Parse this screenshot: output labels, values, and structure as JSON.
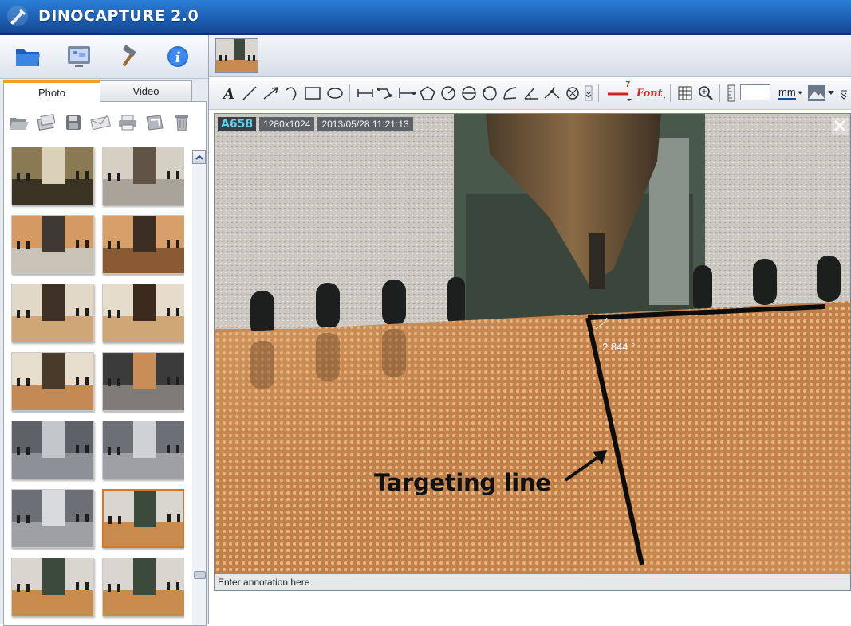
{
  "app": {
    "title": "DINOCAPTURE 2.0",
    "accent_color": "#1c5fb3",
    "selected_color": "#e0751d"
  },
  "left_panel": {
    "top_tools": [
      {
        "name": "folder-icon"
      },
      {
        "name": "monitor-icon"
      },
      {
        "name": "hammer-icon"
      },
      {
        "name": "info-icon"
      }
    ],
    "tabs": [
      {
        "label": "Photo",
        "active": true
      },
      {
        "label": "Video",
        "active": false
      }
    ],
    "photo_tools": [
      "open-folder-icon",
      "export-icon",
      "save-icon",
      "email-icon",
      "print-icon",
      "edit-icon",
      "trash-icon"
    ],
    "thumbnails_count": 14,
    "selected_thumbnail": 11
  },
  "toolbar": {
    "line_width_label": "7",
    "font_label": "Font",
    "unit_label": "mm",
    "value_field": ""
  },
  "viewer": {
    "image_id": "A658",
    "resolution": "1280x1024",
    "timestamp": "2013/05/28 11:21:13",
    "angle_label": "2.844 °",
    "callout": "Targeting line",
    "annotation_placeholder": "Enter annotation here"
  }
}
